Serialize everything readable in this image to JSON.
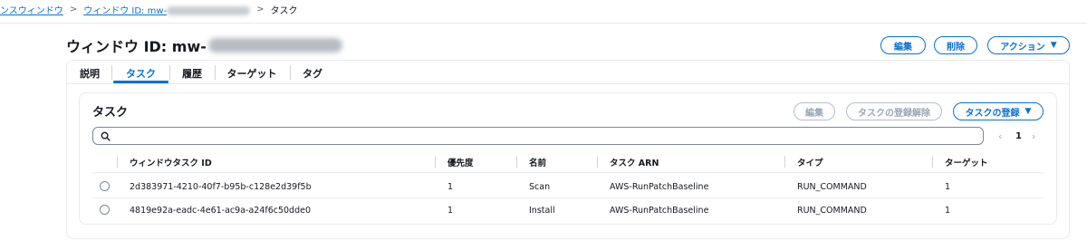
{
  "breadcrumb": {
    "maintenance_windows": "ンスウィンドウ",
    "window_prefix": "ウィンドウ ID: mw-",
    "separator": ">",
    "current": "タスク"
  },
  "header": {
    "title_prefix": "ウィンドウ ID: mw-",
    "edit_label": "編集",
    "delete_label": "削除",
    "actions_label": "アクション",
    "actions_caret": "▼"
  },
  "tabs": [
    {
      "label": "説明"
    },
    {
      "label": "タスク"
    },
    {
      "label": "履歴"
    },
    {
      "label": "ターゲット"
    },
    {
      "label": "タグ"
    }
  ],
  "tasks": {
    "title": "タスク",
    "edit_label": "編集",
    "deregister_label": "タスクの登録解除",
    "register_label": "タスクの登録",
    "register_caret": "▼",
    "search_value": "",
    "pagination": {
      "prev": "‹",
      "page": "1",
      "next": "›"
    },
    "columns": [
      "ウィンドウタスク ID",
      "優先度",
      "名前",
      "タスク ARN",
      "タイプ",
      "ターゲット"
    ],
    "rows": [
      {
        "id": "2d383971-4210-40f7-b95b-c128e2d39f5b",
        "priority": "1",
        "name": "Scan",
        "arn": "AWS-RunPatchBaseline",
        "type": "RUN_COMMAND",
        "targets": "1"
      },
      {
        "id": "4819e92a-eadc-4e61-ac9a-a24f6c50dde0",
        "priority": "1",
        "name": "Install",
        "arn": "AWS-RunPatchBaseline",
        "type": "RUN_COMMAND",
        "targets": "1"
      }
    ]
  },
  "colors": {
    "accent": "#0972d3",
    "text": "#16191f",
    "border": "#e9ebed",
    "disabled": "#9ba7b6"
  },
  "icons": {
    "search": "search-icon",
    "caret": "caret-down-icon",
    "radio": "radio-button"
  }
}
